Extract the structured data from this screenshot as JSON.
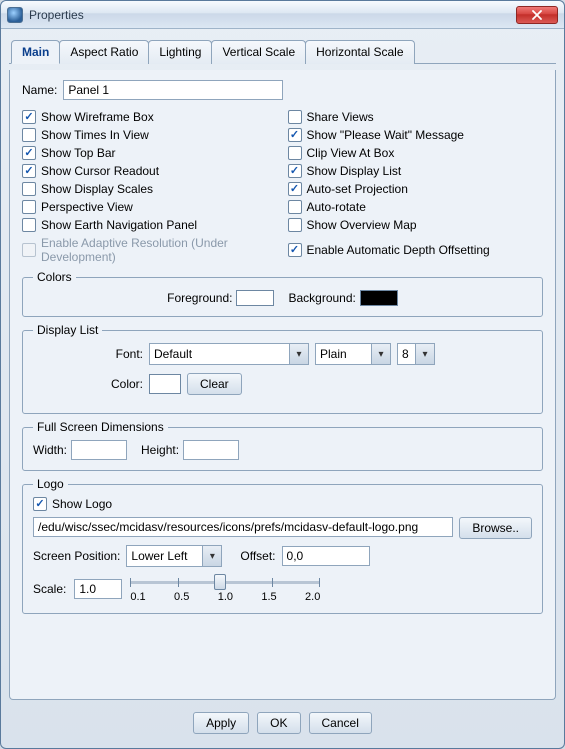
{
  "window": {
    "title": "Properties"
  },
  "tabs": [
    "Main",
    "Aspect Ratio",
    "Lighting",
    "Vertical Scale",
    "Horizontal Scale"
  ],
  "active_tab": 0,
  "name": {
    "label": "Name:",
    "value": "Panel 1"
  },
  "checks_left": [
    {
      "label": "Show Wireframe Box",
      "checked": true
    },
    {
      "label": "Show Times In View",
      "checked": false
    },
    {
      "label": "Show Top Bar",
      "checked": true
    },
    {
      "label": "Show Cursor Readout",
      "checked": true
    },
    {
      "label": "Show Display Scales",
      "checked": false
    },
    {
      "label": "Perspective View",
      "checked": false
    },
    {
      "label": "Show Earth Navigation Panel",
      "checked": false
    },
    {
      "label": "Enable Adaptive Resolution (Under Development)",
      "checked": false,
      "disabled": true
    }
  ],
  "checks_right": [
    {
      "label": "Share Views",
      "checked": false
    },
    {
      "label": "Show \"Please Wait\" Message",
      "checked": true
    },
    {
      "label": "Clip View At Box",
      "checked": false
    },
    {
      "label": "Show Display List",
      "checked": true
    },
    {
      "label": "Auto-set Projection",
      "checked": true
    },
    {
      "label": "Auto-rotate",
      "checked": false
    },
    {
      "label": "Show Overview Map",
      "checked": false
    },
    {
      "label": "Enable Automatic Depth Offsetting",
      "checked": true
    }
  ],
  "colors": {
    "legend": "Colors",
    "fg_label": "Foreground:",
    "fg_value": "#ffffff",
    "bg_label": "Background:",
    "bg_value": "#000000"
  },
  "display_list": {
    "legend": "Display List",
    "font_label": "Font:",
    "font_value": "Default",
    "style_value": "Plain",
    "size_value": "8",
    "color_label": "Color:",
    "color_value": "#ffffff",
    "clear_label": "Clear"
  },
  "fsd": {
    "legend": "Full Screen Dimensions",
    "width_label": "Width:",
    "width_value": "",
    "height_label": "Height:",
    "height_value": ""
  },
  "logo": {
    "legend": "Logo",
    "show_label": "Show Logo",
    "show_checked": true,
    "path": "/edu/wisc/ssec/mcidasv/resources/icons/prefs/mcidasv-default-logo.png",
    "browse_label": "Browse..",
    "pos_label": "Screen Position:",
    "pos_value": "Lower Left",
    "offset_label": "Offset:",
    "offset_value": "0,0",
    "scale_label": "Scale:",
    "scale_value": "1.0",
    "scale_ticks": [
      "0.1",
      "0.5",
      "1.0",
      "1.5",
      "2.0"
    ]
  },
  "buttons": {
    "apply": "Apply",
    "ok": "OK",
    "cancel": "Cancel"
  }
}
